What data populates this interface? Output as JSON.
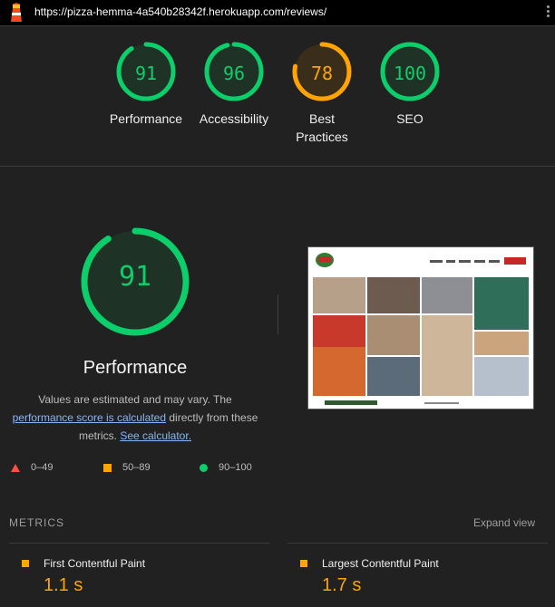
{
  "topbar": {
    "url": "https://pizza-hemma-4a540b28342f.herokuapp.com/reviews/"
  },
  "gauges": [
    {
      "score": "91",
      "label": "Performance",
      "fraction": 0.91,
      "color": "#0cce6b"
    },
    {
      "score": "96",
      "label": "Accessibility",
      "fraction": 0.96,
      "color": "#0cce6b"
    },
    {
      "score": "78",
      "label": "Best Practices",
      "fraction": 0.78,
      "color": "#ffa400"
    },
    {
      "score": "100",
      "label": "SEO",
      "fraction": 1.0,
      "color": "#0cce6b"
    }
  ],
  "performance": {
    "score": "91",
    "fraction": 0.91,
    "title": "Performance",
    "desc_1": "Values are estimated and may vary. The",
    "desc_link_1": "performance score is calculated",
    "desc_2": "directly from these metrics.",
    "desc_link_2": "See calculator."
  },
  "legend": {
    "fail": "0–49",
    "average": "50–89",
    "pass": "90–100"
  },
  "metrics": {
    "title": "METRICS",
    "expand": "Expand view",
    "items": [
      {
        "name": "First Contentful Paint",
        "value": "1.1 s"
      },
      {
        "name": "Largest Contentful Paint",
        "value": "1.7 s"
      }
    ]
  },
  "colors": {
    "pass": "#0cce6b",
    "average": "#ffa400",
    "fail": "#ff4e42",
    "link": "#8ab4f8"
  }
}
